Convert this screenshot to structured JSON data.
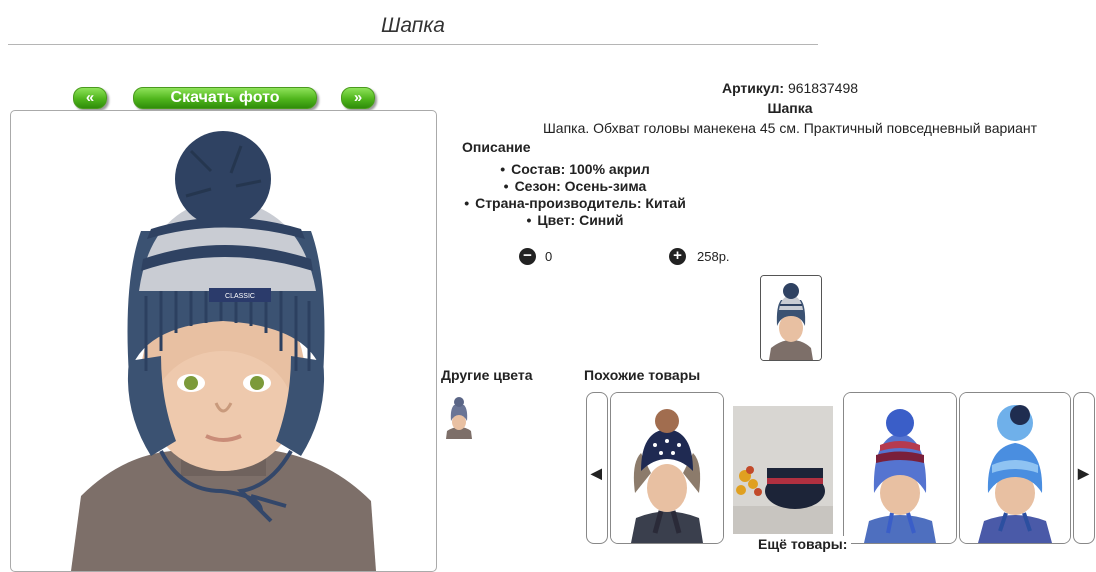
{
  "page": {
    "title": "Шапка"
  },
  "gallery": {
    "prev_label": "«",
    "download_label": "Скачать фото",
    "next_label": "»"
  },
  "product": {
    "article_label": "Артикул:",
    "article_value": "961837498",
    "name": "Шапка",
    "summary": "Шапка. Обхват головы манекена 45 см. Практичный повседневный вариант",
    "description_title": "Описание",
    "properties": [
      "Состав: 100% акрил",
      "Сезон: Осень-зима",
      "Страна-производитель: Китай",
      "Цвет: Синий"
    ],
    "quantity": "0",
    "price": "258р.",
    "main_colors": {
      "hat": "#3b5272",
      "stripe": "#c9ccd3",
      "pompom": "#2f4262",
      "sweater": "#7d6f69"
    }
  },
  "other_colors": {
    "title": "Другие цвета"
  },
  "similar": {
    "title": "Похожие товары",
    "prev_icon": "chevron-left-icon",
    "next_icon": "chevron-right-icon",
    "more_label": "Ещё товары:"
  }
}
